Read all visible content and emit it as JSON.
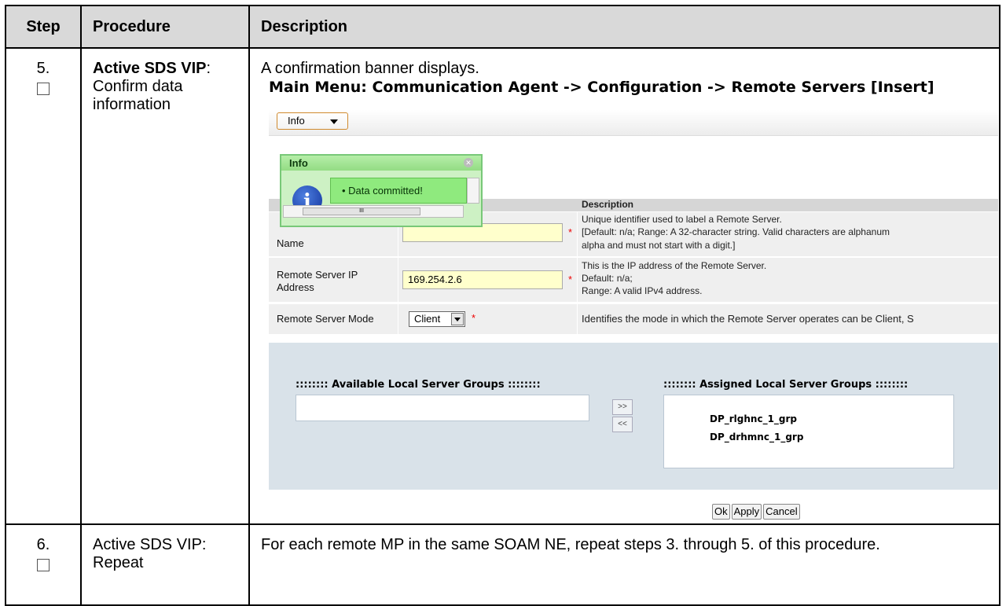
{
  "table": {
    "headers": {
      "step": "Step",
      "procedure": "Procedure",
      "description": "Description"
    },
    "rows": [
      {
        "step": "5.",
        "procedure_bold": "Active SDS VIP",
        "procedure_rest": ": Confirm data information",
        "description": "A confirmation banner displays."
      },
      {
        "step": "6.",
        "procedure": "Active SDS VIP:  Repeat",
        "description": "For each remote MP in the same SOAM NE, repeat steps 3. through 5. of this procedure."
      }
    ]
  },
  "screenshot": {
    "title": "Main Menu: Communication Agent -> Configuration -> Remote Servers [Insert]",
    "info_button": "Info",
    "popup": {
      "title": "Info",
      "message": "Data committed!",
      "icon": "info-icon"
    },
    "form": {
      "description_header": "Description",
      "name_label": "Name",
      "name_desc_1": "Unique identifier used to label a Remote Server.",
      "name_desc_2": "[Default: n/a; Range: A 32-character string. Valid characters are alphanum",
      "name_desc_3": "alpha and must not start with a digit.]",
      "ip_label": "Remote Server IP Address",
      "ip_value": "169.254.2.6",
      "ip_desc_1": "This is the IP address of the Remote Server.",
      "ip_desc_2": "Default: n/a;",
      "ip_desc_3": "Range: A valid IPv4 address.",
      "mode_label": "Remote Server Mode",
      "mode_value": "Client",
      "mode_desc": "Identifies the mode in which the Remote Server operates can be Client, S",
      "required_mark": "*"
    },
    "groups": {
      "available_title": ":::::::: Available Local Server Groups ::::::::",
      "assigned_title": ":::::::: Assigned Local Server Groups ::::::::",
      "assigned_items": [
        "DP_rlghnc_1_grp",
        "DP_drhmnc_1_grp"
      ],
      "move_right": ">>",
      "move_left": "<<"
    },
    "buttons": {
      "ok": "Ok",
      "apply": "Apply",
      "cancel": "Cancel"
    }
  }
}
